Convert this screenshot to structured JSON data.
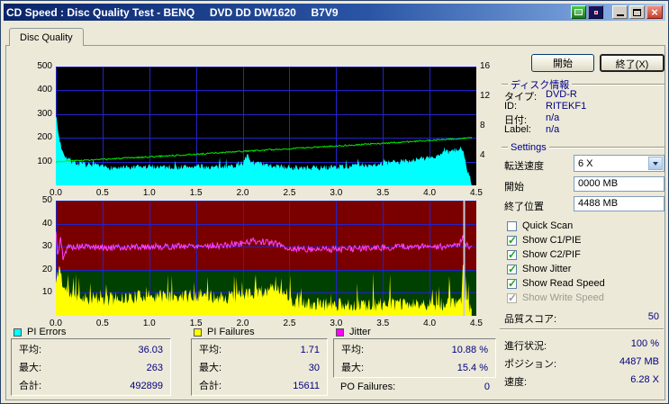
{
  "window": {
    "title": "CD Speed : Disc Quality Test - BENQ     DVD DD DW1620     B7V9"
  },
  "tab": {
    "label": "Disc Quality"
  },
  "right_panel": {
    "start_button": "開始",
    "exit_button": "終了(X)",
    "disc_info": {
      "title": "ディスク情報",
      "rows": [
        {
          "label": "タイプ:",
          "value": "DVD-R"
        },
        {
          "label": "ID:",
          "value": "RITEKF1"
        },
        {
          "label": "日付:",
          "value": "n/a"
        },
        {
          "label": "Label:",
          "value": "n/a"
        }
      ]
    },
    "settings": {
      "title": "Settings",
      "speed_label": "転送速度",
      "speed_value": "6 X",
      "start_label": "開始",
      "start_value": "0000 MB",
      "end_label": "終了位置",
      "end_value": "4488 MB",
      "checkboxes": [
        {
          "label": "Quick Scan",
          "checked": false,
          "disabled": false
        },
        {
          "label": "Show C1/PIE",
          "checked": true,
          "disabled": false
        },
        {
          "label": "Show C2/PIF",
          "checked": true,
          "disabled": false
        },
        {
          "label": "Show Jitter",
          "checked": true,
          "disabled": false
        },
        {
          "label": "Show Read Speed",
          "checked": true,
          "disabled": false
        },
        {
          "label": "Show Write Speed",
          "checked": true,
          "disabled": true
        }
      ]
    },
    "quality_score": {
      "label": "品質スコア:",
      "value": "50"
    },
    "progress": {
      "label": "進行状況:",
      "value": "100 %"
    },
    "position": {
      "label": "ポジション:",
      "value": "4487 MB"
    },
    "speed": {
      "label": "速度:",
      "value": "6.28 X"
    }
  },
  "stats": [
    {
      "swatch": "#00ffff",
      "title": "PI Errors",
      "rows": [
        {
          "label": "平均:",
          "value": "36.03"
        },
        {
          "label": "最大:",
          "value": "263"
        },
        {
          "label": "合計:",
          "value": "492899"
        }
      ]
    },
    {
      "swatch": "#ffff00",
      "title": "PI Failures",
      "rows": [
        {
          "label": "平均:",
          "value": "1.71"
        },
        {
          "label": "最大:",
          "value": "30"
        },
        {
          "label": "合計:",
          "value": "15611"
        }
      ]
    },
    {
      "swatch": "#ff00ff",
      "title": "Jitter",
      "rows": [
        {
          "label": "平均:",
          "value": "10.88 %"
        },
        {
          "label": "最大:",
          "value": "15.4 %"
        }
      ],
      "extra": {
        "label": "PO Failures:",
        "value": "0"
      }
    }
  ],
  "chart_data": [
    {
      "type": "area",
      "name": "PI Errors / Read Speed",
      "bg": "#000000",
      "grid_color": "#2323cc",
      "xlim": [
        0,
        4.5
      ],
      "x_ticks": [
        "0.0",
        "0.5",
        "1.0",
        "1.5",
        "2.0",
        "2.5",
        "3.0",
        "3.5",
        "4.0",
        "4.5"
      ],
      "left_axis": {
        "max": 500,
        "ticks": [
          100,
          200,
          300,
          400,
          500
        ]
      },
      "right_axis": {
        "max": 16,
        "ticks": [
          4,
          8,
          12,
          16
        ]
      },
      "series": [
        {
          "name": "PI Errors",
          "color": "#00ffff",
          "fill": true,
          "seed": 7,
          "noise": 12,
          "spike_prob": 0.05,
          "spike_amp": 40,
          "points": [
            [
              0,
              300
            ],
            [
              0.03,
              210
            ],
            [
              0.06,
              160
            ],
            [
              0.1,
              125
            ],
            [
              0.15,
              105
            ],
            [
              0.2,
              95
            ],
            [
              0.3,
              88
            ],
            [
              0.5,
              78
            ],
            [
              0.7,
              72
            ],
            [
              0.9,
              76
            ],
            [
              1.1,
              80
            ],
            [
              1.3,
              76
            ],
            [
              1.5,
              80
            ],
            [
              1.7,
              76
            ],
            [
              1.9,
              82
            ],
            [
              2.0,
              92
            ],
            [
              2.05,
              125
            ],
            [
              2.1,
              98
            ],
            [
              2.2,
              88
            ],
            [
              2.3,
              82
            ],
            [
              2.5,
              76
            ],
            [
              2.7,
              72
            ],
            [
              2.9,
              76
            ],
            [
              3.1,
              80
            ],
            [
              3.3,
              85
            ],
            [
              3.5,
              92
            ],
            [
              3.7,
              100
            ],
            [
              3.9,
              112
            ],
            [
              4.05,
              120
            ],
            [
              4.2,
              140
            ],
            [
              4.3,
              150
            ],
            [
              4.36,
              158
            ],
            [
              4.4,
              70
            ],
            [
              4.44,
              25
            ],
            [
              4.45,
              0
            ]
          ]
        },
        {
          "name": "Read Speed",
          "color": "#00ee00",
          "fill": false,
          "seed": 3,
          "noise": 3,
          "points": [
            [
              0,
              100
            ],
            [
              0.5,
              109
            ],
            [
              1.0,
              120
            ],
            [
              1.5,
              131
            ],
            [
              2.0,
              143
            ],
            [
              2.5,
              154
            ],
            [
              3.0,
              166
            ],
            [
              3.5,
              177
            ],
            [
              4.0,
              189
            ],
            [
              4.45,
              200
            ]
          ]
        }
      ]
    },
    {
      "type": "area",
      "name": "PI Failures / Jitter",
      "bg": "#7a0000",
      "bands": [
        {
          "from": 0,
          "to": 20,
          "color": "#004000"
        }
      ],
      "grid_color": "#2323cc",
      "xlim": [
        0,
        4.5
      ],
      "x_ticks": [
        "0.0",
        "0.5",
        "1.0",
        "1.5",
        "2.0",
        "2.5",
        "3.0",
        "3.5",
        "4.0",
        "4.5"
      ],
      "left_axis": {
        "max": 50,
        "ticks": [
          10,
          20,
          30,
          40,
          50
        ]
      },
      "markers": [
        {
          "x": 4.37,
          "color": "#c9c9d6"
        }
      ],
      "series": [
        {
          "name": "PI Failures",
          "color": "#ffff00",
          "fill": true,
          "seed": 11,
          "noise": 3,
          "spike_prob": 0.09,
          "spike_amp": 12,
          "points": [
            [
              0,
              14
            ],
            [
              0.04,
              22
            ],
            [
              0.08,
              12
            ],
            [
              0.15,
              10
            ],
            [
              0.3,
              8
            ],
            [
              0.5,
              7
            ],
            [
              0.8,
              8
            ],
            [
              1.0,
              9
            ],
            [
              1.2,
              8
            ],
            [
              1.5,
              9
            ],
            [
              1.8,
              8
            ],
            [
              2.0,
              9
            ],
            [
              2.2,
              10
            ],
            [
              2.35,
              13
            ],
            [
              2.45,
              8
            ],
            [
              2.6,
              5
            ],
            [
              3.0,
              5
            ],
            [
              3.4,
              5
            ],
            [
              3.8,
              5
            ],
            [
              4.1,
              5
            ],
            [
              4.3,
              5
            ],
            [
              4.34,
              6
            ],
            [
              4.36,
              28
            ],
            [
              4.38,
              6
            ],
            [
              4.42,
              4
            ],
            [
              4.45,
              2
            ]
          ]
        },
        {
          "name": "Jitter",
          "color": "#ff40ff",
          "fill": false,
          "seed": 5,
          "noise": 1.4,
          "points": [
            [
              0,
              36
            ],
            [
              0.02,
              26
            ],
            [
              0.05,
              34
            ],
            [
              0.08,
              24
            ],
            [
              0.12,
              30
            ],
            [
              0.3,
              30
            ],
            [
              0.6,
              29.5
            ],
            [
              0.9,
              30
            ],
            [
              1.2,
              30
            ],
            [
              1.5,
              30.5
            ],
            [
              1.8,
              30.5
            ],
            [
              2.0,
              31.5
            ],
            [
              2.1,
              32.5
            ],
            [
              2.25,
              32
            ],
            [
              2.4,
              31
            ],
            [
              2.5,
              29
            ],
            [
              2.8,
              29
            ],
            [
              3.1,
              29
            ],
            [
              3.4,
              29.5
            ],
            [
              3.7,
              30
            ],
            [
              4.0,
              30
            ],
            [
              4.2,
              30
            ],
            [
              4.3,
              30
            ],
            [
              4.36,
              34
            ],
            [
              4.4,
              30.5
            ],
            [
              4.45,
              30
            ]
          ]
        }
      ]
    }
  ]
}
